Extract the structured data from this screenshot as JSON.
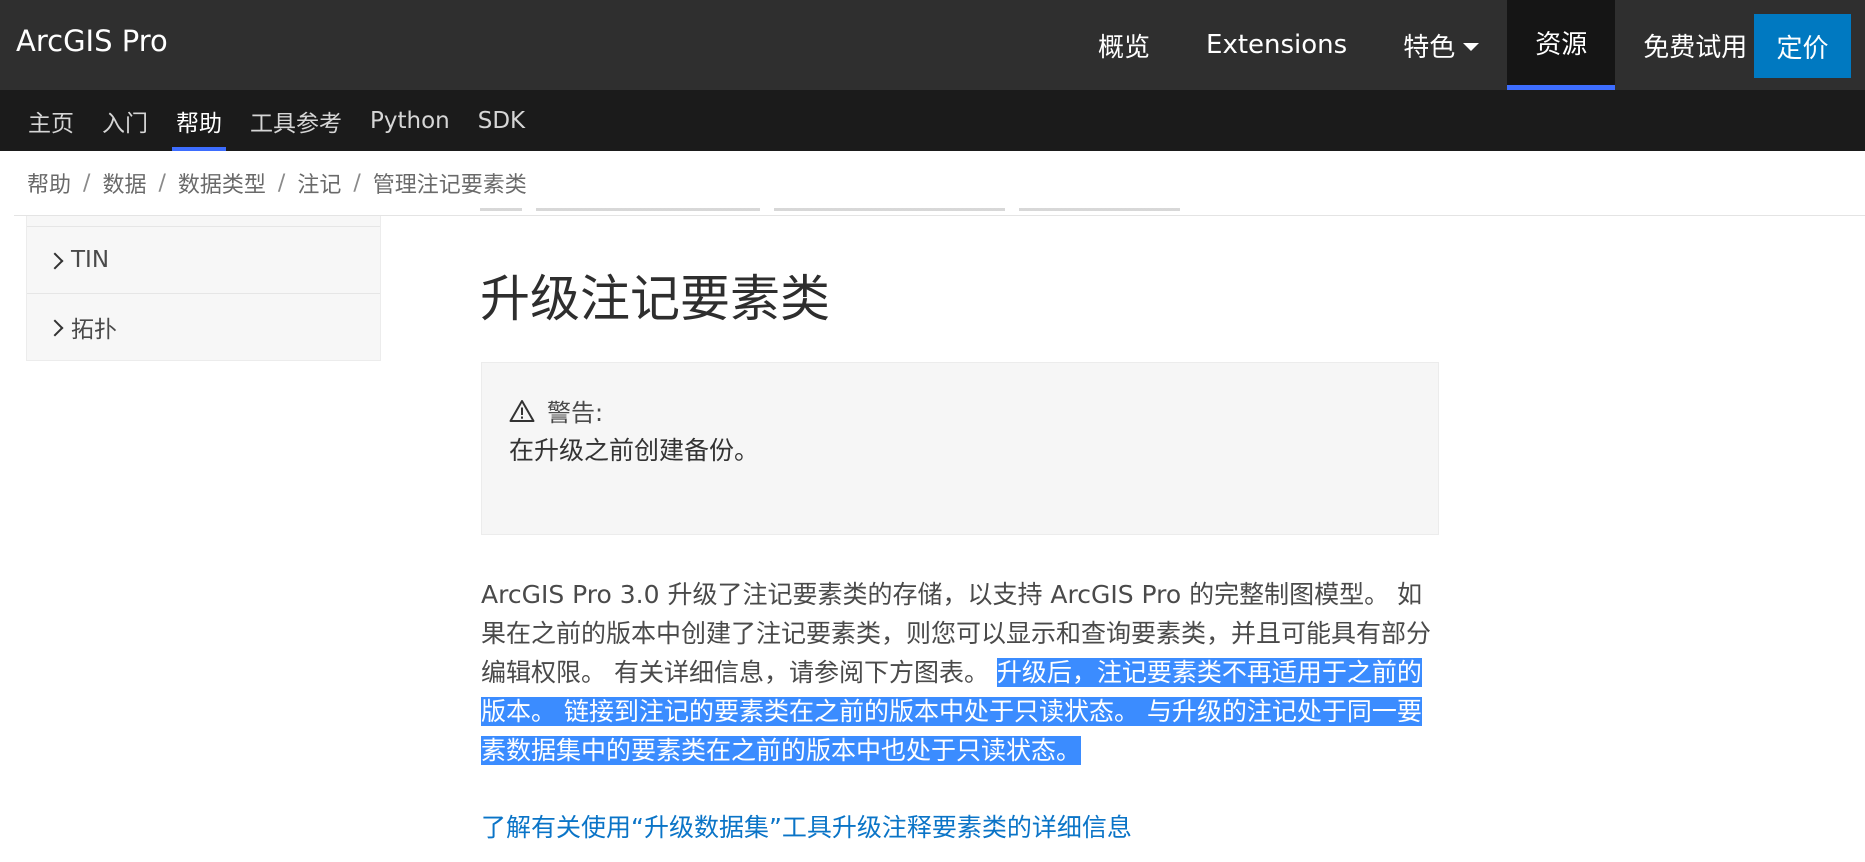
{
  "header": {
    "brand": "ArcGIS Pro",
    "nav": [
      {
        "label": "概览"
      },
      {
        "label": "Extensions"
      },
      {
        "label": "特色"
      },
      {
        "label": "资源"
      },
      {
        "label": "免费试用"
      }
    ],
    "price_button": "定价"
  },
  "subnav": {
    "items": [
      {
        "label": "主页"
      },
      {
        "label": "入门"
      },
      {
        "label": "帮助"
      },
      {
        "label": "工具参考"
      },
      {
        "label": "Python"
      },
      {
        "label": "SDK"
      }
    ],
    "active": "帮助"
  },
  "breadcrumb": [
    "帮助",
    "数据",
    "数据类型",
    "注记",
    "管理注记要素类"
  ],
  "sidebar": {
    "items": [
      {
        "label": "TIN"
      },
      {
        "label": "拓扑"
      }
    ]
  },
  "main": {
    "title": "升级注记要素类",
    "warning": {
      "label": "警告:",
      "text": "在升级之前创建备份。"
    },
    "paragraph": {
      "normal": "ArcGIS Pro 3.0 升级了注记要素类的存储，以支持 ArcGIS Pro 的完整制图模型。 如果在之前的版本中创建了注记要素类，则您可以显示和查询要素类，并且可能具有部分编辑权限。 有关详细信息，请参阅下方图表。 ",
      "highlighted": "升级后，注记要素类不再适用于之前的版本。 链接到注记的要素类在之前的版本中处于只读状态。 与升级的注记处于同一要素数据集中的要素类在之前的版本中也处于只读状态。"
    },
    "link": "了解有关使用“升级数据集”工具升级注释要素类的详细信息"
  },
  "colors": {
    "topbar": "#2f2f2f",
    "subnav": "#1b1b1b",
    "accent": "#0079c1",
    "active_underline": "#3d6dff",
    "selection": "#3b8cff",
    "link": "#0a74c7"
  }
}
